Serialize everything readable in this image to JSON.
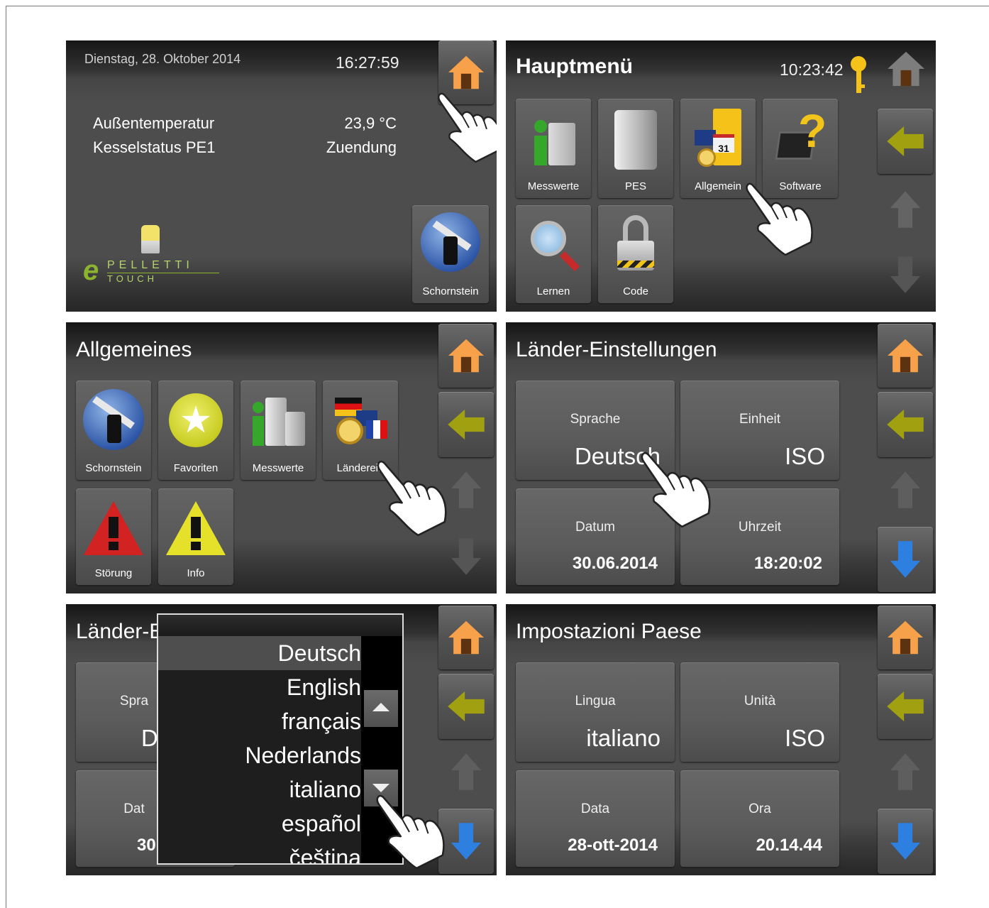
{
  "screens": {
    "home": {
      "date": "Dienstag, 28. Oktober 2014",
      "time": "16:27:59",
      "rows": [
        {
          "label": "Außentemperatur",
          "value": "23,9 °C"
        },
        {
          "label": "Kesselstatus PE1",
          "value": "Zuendung"
        }
      ],
      "logo_main": "PELLETTI",
      "logo_sub": "TOUCH",
      "schornstein_label": "Schornstein"
    },
    "hauptmenu": {
      "title": "Hauptmenü",
      "time": "10:23:42",
      "tiles": [
        "Messwerte",
        "PES",
        "Allgemein",
        "Software",
        "Lernen",
        "Code"
      ]
    },
    "allgemeines": {
      "title": "Allgemeines",
      "tiles": [
        "Schornstein",
        "Favoriten",
        "Messwerte",
        "Länderein",
        "Störung",
        "Info"
      ]
    },
    "laender": {
      "title": "Länder-Einstellungen",
      "cells": [
        {
          "label": "Sprache",
          "value": "Deutsch"
        },
        {
          "label": "Einheit",
          "value": "ISO"
        },
        {
          "label": "Datum",
          "value": "30.06.2014"
        },
        {
          "label": "Uhrzeit",
          "value": "18:20:02"
        }
      ]
    },
    "dropdown": {
      "title_partial": "Länder-E",
      "bg_cells": [
        {
          "label": "Spra",
          "value": "D"
        },
        {
          "label": "Dat",
          "value": "30."
        }
      ],
      "options": [
        "Deutsch",
        "English",
        "français",
        "Nederlands",
        "italiano",
        "español",
        "čeština"
      ],
      "selected": "Deutsch"
    },
    "impostazioni": {
      "title": "Impostazioni Paese",
      "cells": [
        {
          "label": "Lingua",
          "value": "italiano"
        },
        {
          "label": "Unità",
          "value": "ISO"
        },
        {
          "label": "Data",
          "value": "28-ott-2014"
        },
        {
          "label": "Ora",
          "value": "20.14.44"
        }
      ]
    }
  },
  "icons": {
    "home": "home-icon",
    "back": "arrow-left-icon",
    "up": "arrow-up-icon",
    "down": "arrow-down-icon",
    "key": "key-icon",
    "hand": "pointing-hand-icon"
  },
  "colors": {
    "home_orange": "#f7a24a",
    "back_green": "#a0a010",
    "down_blue": "#2d7fe0",
    "key_yellow": "#f5c21a",
    "disabled_gray": "#666666"
  }
}
